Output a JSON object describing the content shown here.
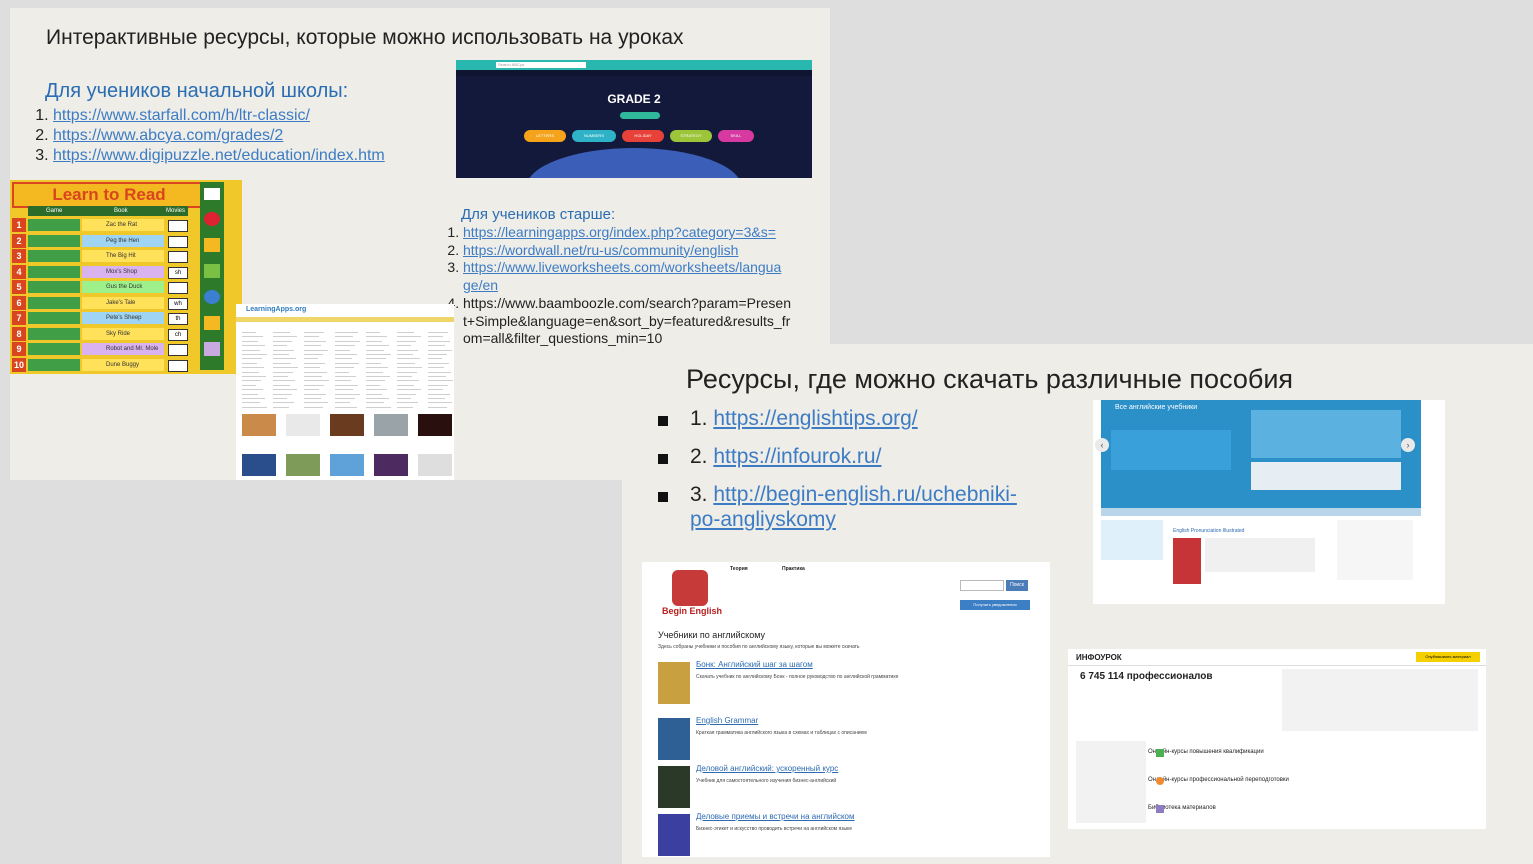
{
  "slide1": {
    "title": "Интерактивные ресурсы, которые можно использовать на уроках",
    "primary_heading": "Для учеников начальной школы:",
    "primary_links": [
      "https://www.starfall.com/h/ltr-classic/",
      "https://www.abcya.com/grades/2",
      "https://www.digipuzzle.net/education/index.htm"
    ],
    "older_heading": "Для учеников старше:",
    "older_links": [
      "https://learningapps.org/index.php?category=3&s=",
      "https://wordwall.net/ru-us/community/english",
      "https://www.liveworksheets.com/worksheets/language/en",
      "https://www.baamboozle.com/search?param=Present+Simple&language=en&sort_by=featured&results_from=all&filter_questions_min=10"
    ],
    "older_links_lines": [
      [
        "https://learningapps.org/index.php?category=3&s="
      ],
      [
        "https://wordwall.net/ru-us/community/english"
      ],
      [
        "https://www.liveworksheets.com/worksheets/langua",
        "ge/en"
      ],
      [
        "https://www.baamboozle.com/search?param=Presen",
        "t+Simple&language=en&sort_by=featured&results_fr",
        "om=all&filter_questions_min=10"
      ]
    ],
    "thumb_learn_to_read": {
      "title": "Learn to Read",
      "col_game": "Game",
      "col_book": "Book",
      "col_movies": "Movies",
      "books": [
        "Zac the Rat",
        "Peg the Hen",
        "The Big Hit",
        "Mox's Shop",
        "Gus the Duck",
        "Jake's Tale",
        "Pete's Sheep",
        "Sky Ride",
        "Robot and Mr. Mole",
        "Dune Buggy"
      ],
      "movies": [
        "",
        "",
        "",
        "sh",
        "",
        "wh",
        "th",
        "ch",
        "",
        ""
      ]
    },
    "thumb_grade": {
      "title": "GRADE 2",
      "search_placeholder": "Search ABCya",
      "buttons": [
        "LETTERS",
        "NUMBERS",
        "HOLIDAY",
        "STRATEGY",
        "SKILL"
      ]
    },
    "thumb_learningapps": {
      "logo": "LearningApps.org"
    }
  },
  "slide2": {
    "title": "Ресурсы, где можно скачать различные пособия",
    "items": [
      {
        "num": "1.",
        "lines": [
          "https://englishtips.org/"
        ]
      },
      {
        "num": "2.",
        "lines": [
          "https://infourok.ru/"
        ]
      },
      {
        "num": "3.",
        "lines": [
          "http://begin-english.ru/uchebniki-",
          "po-angliyskomy"
        ]
      }
    ],
    "thumb_englishtips": {
      "title": "Все английские учебники",
      "arrow_left": "‹",
      "arrow_right": "›",
      "book_title": "English Pronunciation Illustrated"
    },
    "thumb_begin_english": {
      "logo": "Begin English",
      "heading": "Учебники по английскому",
      "subheading": "Здесь собраны учебники и пособия по английскому языку, которые вы можете скачать",
      "search_button": "Поиск",
      "notify_button": "Получать уведомления",
      "menu_theory": "Теория",
      "menu_practice": "Практика",
      "books": [
        {
          "title": "Бонк: Английский шаг за шагом",
          "desc": "Скачать учебник по английскому Бонк - полное руководство по английской грамматике"
        },
        {
          "title": "English Grammar",
          "desc": "Краткая грамматика английского языка в схемах и таблицах с описанием"
        },
        {
          "title": "Деловой английский: ускоренный курс",
          "desc": "Учебник для самостоятельного изучения бизнес-английский"
        },
        {
          "title": "Деловые приемы и встречи на английском",
          "desc": "Бизнес-этикет и искусство проводить встречи на английском языке"
        }
      ]
    },
    "thumb_infourok": {
      "logo": "ИНФОУРОК",
      "publish_button": "Опубликовать материал",
      "count": "6 745 114 профессионалов",
      "rows": [
        "Онлайн-курсы повышения квалификации",
        "Онлайн-курсы профессиональной переподготовки",
        "Библиотека материалов"
      ]
    }
  }
}
